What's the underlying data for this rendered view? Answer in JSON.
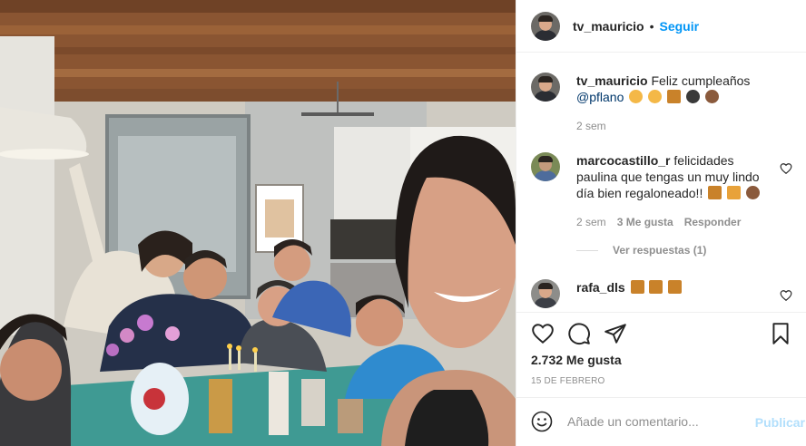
{
  "header": {
    "username": "tv_mauricio",
    "separator": "•",
    "follow_label": "Seguir"
  },
  "caption": {
    "username": "tv_mauricio",
    "text": "Feliz cumpleaños",
    "mention": "@pflano",
    "emojis": [
      "smiling-face-with-hearts",
      "smiling-face-with-hearts",
      "party-popper",
      "balloon",
      "cupcake"
    ],
    "time": "2 sem"
  },
  "comments": [
    {
      "username": "marcocastillo_r",
      "text": "felicidades paulina que tengas un muy lindo día bien regaloneado!!",
      "emojis": [
        "party-popper",
        "gift",
        "cupcake"
      ],
      "time": "2 sem",
      "likes": "3 Me gusta",
      "reply_label": "Responder",
      "view_replies": "Ver respuestas (1)"
    },
    {
      "username": "rafa_dls",
      "emojis": [
        "party-popper",
        "party-popper",
        "party-popper"
      ]
    }
  ],
  "post": {
    "likes": "2.732 Me gusta",
    "date": "15 DE FEBRERO"
  },
  "add_comment": {
    "placeholder": "Añade un comentario...",
    "publish_label": "Publicar"
  },
  "colors": {
    "link_blue": "#0095f6",
    "publish_disabled": "#b2dffc",
    "muted": "#8e8e8e",
    "text": "#262626"
  }
}
